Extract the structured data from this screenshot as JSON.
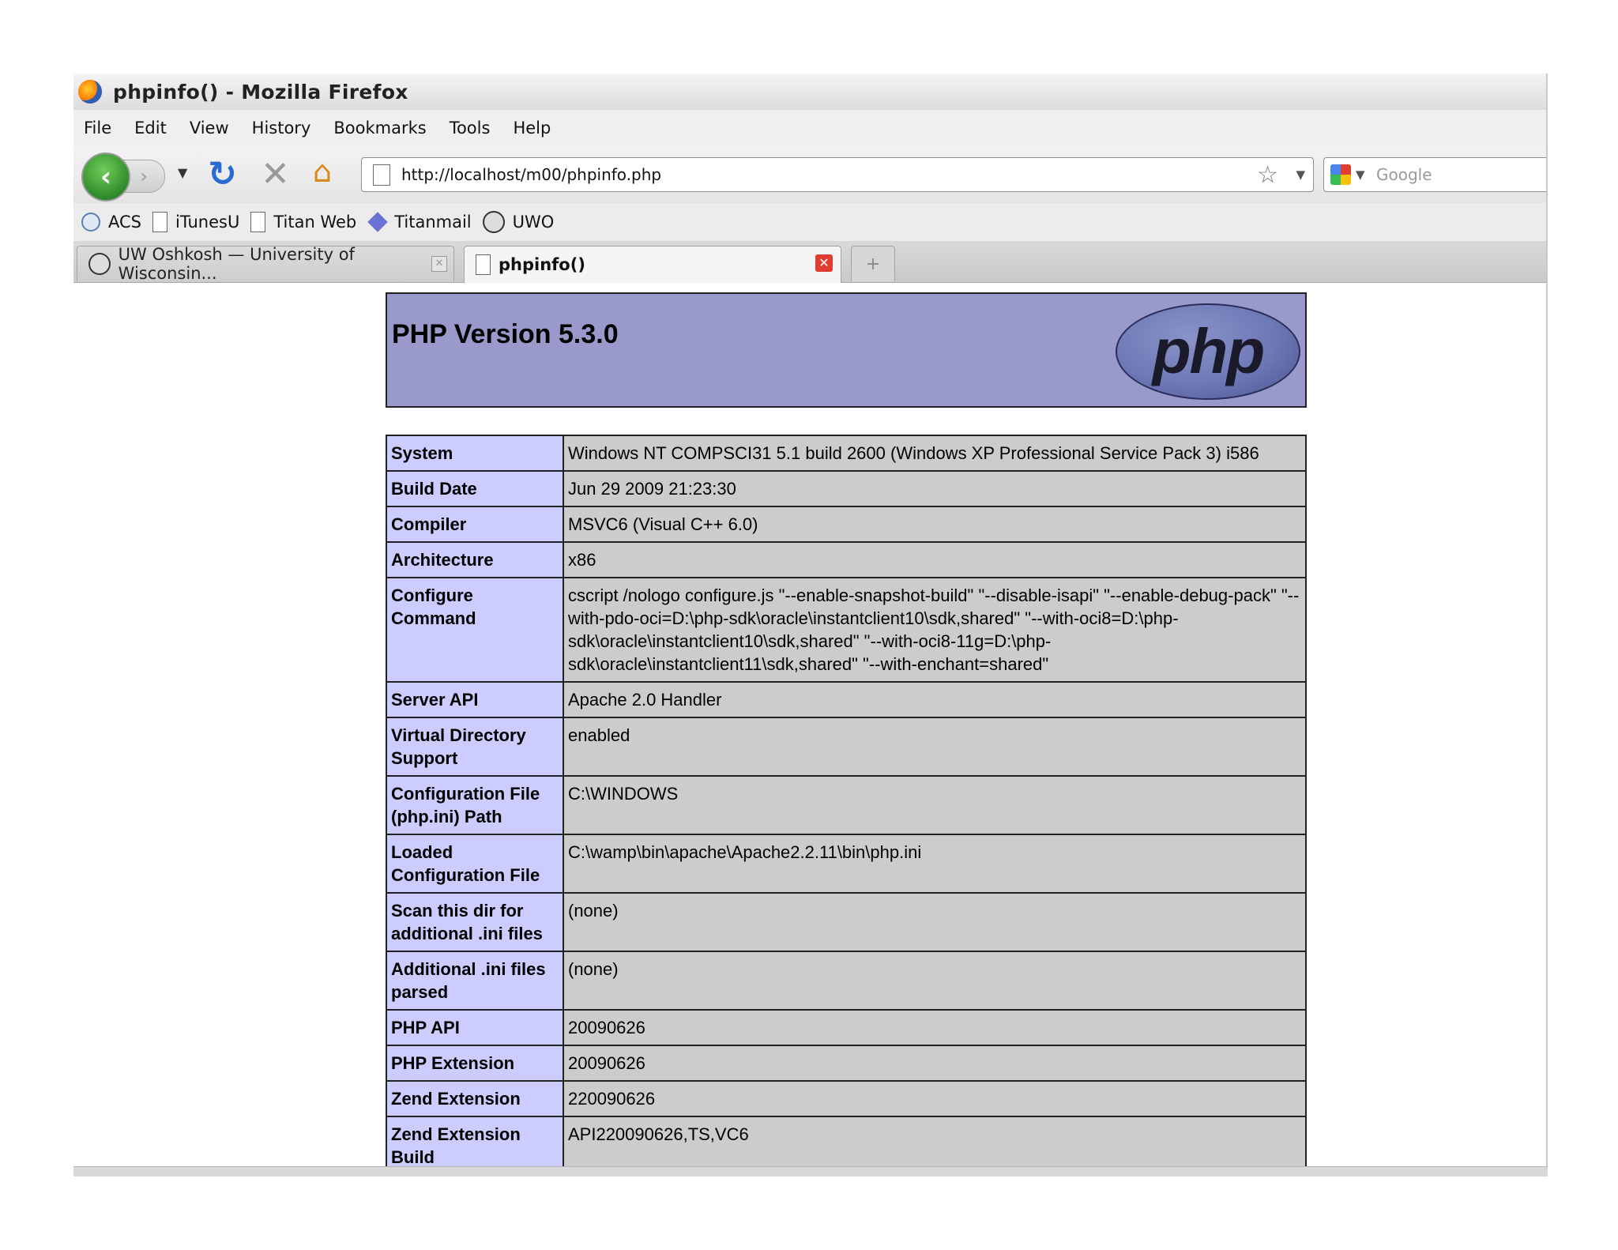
{
  "window": {
    "title": "phpinfo() - Mozilla Firefox"
  },
  "menu": [
    "File",
    "Edit",
    "View",
    "History",
    "Bookmarks",
    "Tools",
    "Help"
  ],
  "nav": {
    "url": "http://localhost/m00/phpinfo.php",
    "search_placeholder": "Google"
  },
  "bookmarks": [
    {
      "label": "ACS",
      "icon": "circle-icon"
    },
    {
      "label": "iTunesU",
      "icon": "page-icon"
    },
    {
      "label": "Titan Web",
      "icon": "page-icon"
    },
    {
      "label": "Titanmail",
      "icon": "diamond-icon"
    },
    {
      "label": "UWO",
      "icon": "seal-icon"
    }
  ],
  "tabs": [
    {
      "label": "UW Oshkosh — University of Wisconsin...",
      "active": false
    },
    {
      "label": "phpinfo()",
      "active": true
    }
  ],
  "page": {
    "version": "PHP Version 5.3.0",
    "logo_text": "php",
    "rows": [
      {
        "key": "System",
        "value": "Windows NT COMPSCI31 5.1 build 2600 (Windows XP Professional Service Pack 3) i586"
      },
      {
        "key": "Build Date",
        "value": "Jun 29 2009 21:23:30"
      },
      {
        "key": "Compiler",
        "value": "MSVC6 (Visual C++ 6.0)"
      },
      {
        "key": "Architecture",
        "value": "x86"
      },
      {
        "key": "Configure Command",
        "value": "cscript /nologo configure.js \"--enable-snapshot-build\" \"--disable-isapi\" \"--enable-debug-pack\" \"--with-pdo-oci=D:\\php-sdk\\oracle\\instantclient10\\sdk,shared\" \"--with-oci8=D:\\php-sdk\\oracle\\instantclient10\\sdk,shared\" \"--with-oci8-11g=D:\\php-sdk\\oracle\\instantclient11\\sdk,shared\" \"--with-enchant=shared\""
      },
      {
        "key": "Server API",
        "value": "Apache 2.0 Handler"
      },
      {
        "key": "Virtual Directory Support",
        "value": "enabled"
      },
      {
        "key": "Configuration File (php.ini) Path",
        "value": "C:\\WINDOWS"
      },
      {
        "key": "Loaded Configuration File",
        "value": "C:\\wamp\\bin\\apache\\Apache2.2.11\\bin\\php.ini"
      },
      {
        "key": "Scan this dir for additional .ini files",
        "value": "(none)"
      },
      {
        "key": "Additional .ini files parsed",
        "value": "(none)"
      },
      {
        "key": "PHP API",
        "value": "20090626"
      },
      {
        "key": "PHP Extension",
        "value": "20090626"
      },
      {
        "key": "Zend Extension",
        "value": "220090626"
      },
      {
        "key": "Zend Extension Build",
        "value": "API220090626,TS,VC6"
      }
    ]
  }
}
